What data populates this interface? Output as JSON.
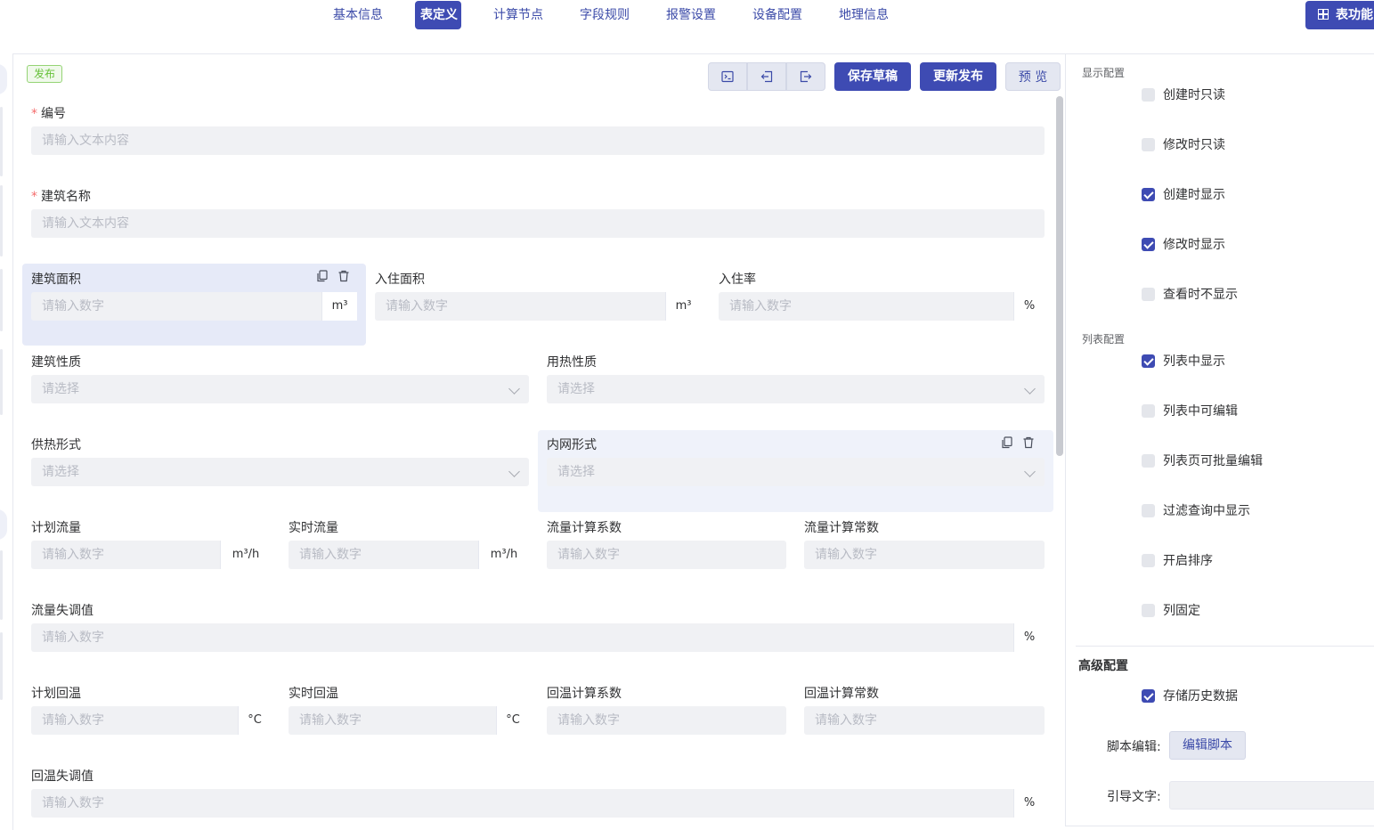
{
  "nav": {
    "tabs": [
      {
        "label": "基本信息",
        "active": false
      },
      {
        "label": "表定义",
        "active": true
      },
      {
        "label": "计算节点",
        "active": false
      },
      {
        "label": "字段规则",
        "active": false
      },
      {
        "label": "报警设置",
        "active": false
      },
      {
        "label": "设备配置",
        "active": false
      },
      {
        "label": "地理信息",
        "active": false
      }
    ],
    "func_button": "表功能"
  },
  "toolbar": {
    "status_tag": "发布",
    "save_draft": "保存草稿",
    "update_publish": "更新发布",
    "preview": "预 览"
  },
  "form": {
    "code": {
      "label": "编号",
      "required": true,
      "placeholder": "请输入文本内容"
    },
    "building_name": {
      "label": "建筑名称",
      "required": true,
      "placeholder": "请输入文本内容"
    },
    "building_area": {
      "label": "建筑面积",
      "placeholder": "请输入数字",
      "unit": "m³"
    },
    "occupied_area": {
      "label": "入住面积",
      "placeholder": "请输入数字",
      "unit": "m³"
    },
    "occupancy_rate": {
      "label": "入住率",
      "placeholder": "请输入数字",
      "unit": "%"
    },
    "building_nature": {
      "label": "建筑性质",
      "placeholder": "请选择"
    },
    "heat_nature": {
      "label": "用热性质",
      "placeholder": "请选择"
    },
    "heating_form": {
      "label": "供热形式",
      "placeholder": "请选择"
    },
    "intranet_form": {
      "label": "内网形式",
      "placeholder": "请选择"
    },
    "planned_flow": {
      "label": "计划流量",
      "placeholder": "请输入数字",
      "unit": "m³/h"
    },
    "realtime_flow": {
      "label": "实时流量",
      "placeholder": "请输入数字",
      "unit": "m³/h"
    },
    "flow_coef": {
      "label": "流量计算系数",
      "placeholder": "请输入数字"
    },
    "flow_const": {
      "label": "流量计算常数",
      "placeholder": "请输入数字"
    },
    "flow_imbalance": {
      "label": "流量失调值",
      "placeholder": "请输入数字",
      "unit": "%"
    },
    "planned_return_temp": {
      "label": "计划回温",
      "placeholder": "请输入数字",
      "unit": "°C"
    },
    "realtime_return_temp": {
      "label": "实时回温",
      "placeholder": "请输入数字",
      "unit": "°C"
    },
    "return_temp_coef": {
      "label": "回温计算系数",
      "placeholder": "请输入数字"
    },
    "return_temp_const": {
      "label": "回温计算常数",
      "placeholder": "请输入数字"
    },
    "return_temp_imbalance": {
      "label": "回温失调值",
      "placeholder": "请输入数字",
      "unit": "%"
    }
  },
  "panel": {
    "display_title": "显示配置",
    "display_options": [
      {
        "label": "创建时只读",
        "checked": false
      },
      {
        "label": "修改时只读",
        "checked": false
      },
      {
        "label": "创建时显示",
        "checked": true
      },
      {
        "label": "修改时显示",
        "checked": true
      },
      {
        "label": "查看时不显示",
        "checked": false
      }
    ],
    "list_title": "列表配置",
    "list_options": [
      {
        "label": "列表中显示",
        "checked": true
      },
      {
        "label": "列表中可编辑",
        "checked": false
      },
      {
        "label": "列表页可批量编辑",
        "checked": false
      },
      {
        "label": "过滤查询中显示",
        "checked": false
      },
      {
        "label": "开启排序",
        "checked": false
      },
      {
        "label": "列固定",
        "checked": false
      }
    ],
    "advanced_title": "高级配置",
    "store_history": {
      "label": "存储历史数据",
      "checked": true
    },
    "script_label": "脚本编辑:",
    "script_button": "编辑脚本",
    "guide_label": "引导文字:",
    "guide_value": ""
  }
}
